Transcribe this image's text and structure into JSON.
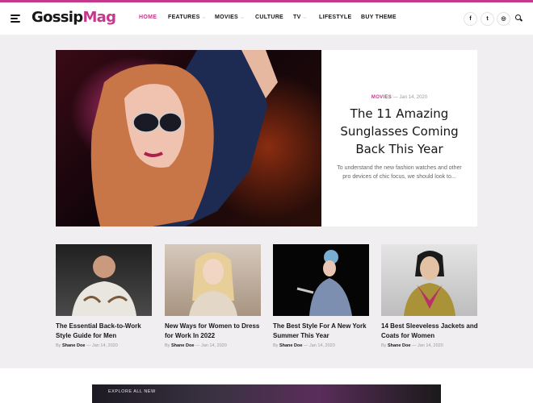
{
  "brand": {
    "logo_part1": "Gossip",
    "logo_part2": "Mag",
    "accent": "#c4388b"
  },
  "nav": [
    {
      "label": "HOME",
      "active": true,
      "dropdown": false
    },
    {
      "label": "FEATURES",
      "active": false,
      "dropdown": true
    },
    {
      "label": "MOVIES",
      "active": false,
      "dropdown": true
    },
    {
      "label": "CULTURE",
      "active": false,
      "dropdown": false
    },
    {
      "label": "TV",
      "active": false,
      "dropdown": true
    },
    {
      "label": "LIFESTYLE",
      "active": false,
      "dropdown": false
    },
    {
      "label": "BUY THEME",
      "active": false,
      "dropdown": false
    }
  ],
  "social": [
    {
      "icon": "facebook-icon",
      "glyph": "f"
    },
    {
      "icon": "twitter-icon",
      "glyph": "t"
    },
    {
      "icon": "instagram-icon",
      "glyph": "◎"
    }
  ],
  "featured": {
    "category": "MOVIES",
    "date": "Jan 14, 2020",
    "title": "The 11 Amazing Sunglasses Coming Back This Year",
    "excerpt": "To understand the new fashion watches and other pro devices of chic focus, we should look to..."
  },
  "posts": [
    {
      "title": "The Essential Back-to-Work Style Guide for Men",
      "by": "By",
      "author": "Shane Doe",
      "date": "Jan 14, 2020"
    },
    {
      "title": "New Ways for Women to Dress for Work In 2022",
      "by": "By",
      "author": "Shane Doe",
      "date": "Jan 14, 2020"
    },
    {
      "title": "The Best Style For A New York Summer This Year",
      "by": "By",
      "author": "Shane Doe",
      "date": "Jan 14, 2020"
    },
    {
      "title": "14 Best Sleeveless Jackets and Coats for Women",
      "by": "By",
      "author": "Shane Doe",
      "date": "Jan 14, 2020"
    }
  ],
  "promo": {
    "text": "EXPLORE ALL NEW"
  }
}
